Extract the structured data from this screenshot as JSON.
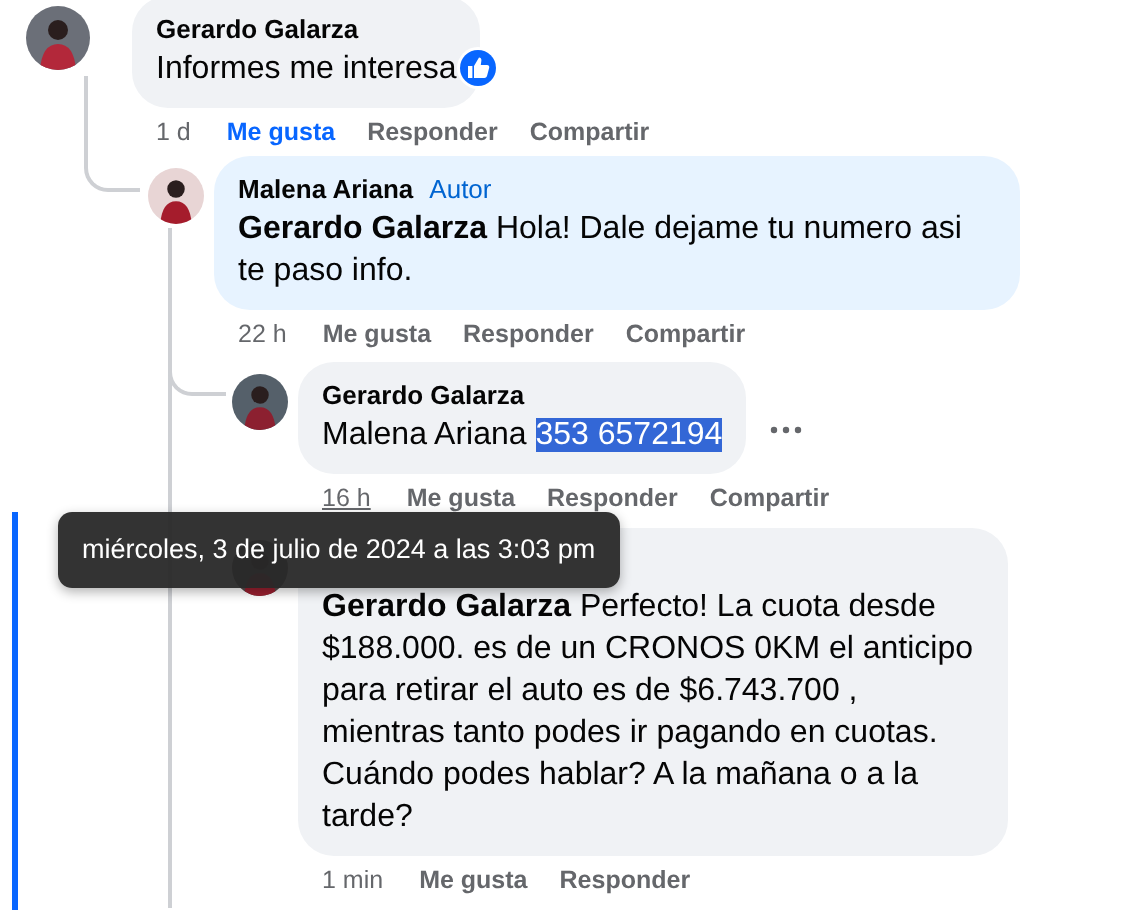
{
  "comments": [
    {
      "author": "Gerardo Galarza",
      "text": "Informes me interesa",
      "like_reaction": true,
      "highlighted": false,
      "more_menu": false,
      "time": "1 d",
      "time_hovered": false,
      "actions": [
        {
          "label": "Me gusta",
          "selected": true
        },
        {
          "label": "Responder",
          "selected": false
        },
        {
          "label": "Compartir",
          "selected": false
        }
      ],
      "children": [
        {
          "author": "Malena Ariana",
          "badge": "Autor",
          "is_author": true,
          "text": "**Gerardo Galarza** Hola! Dale dejame tu numero asi te paso info.",
          "like_reaction": false,
          "highlighted": false,
          "more_menu": false,
          "time": "22 h",
          "time_hovered": false,
          "actions": [
            {
              "label": "Me gusta",
              "selected": false
            },
            {
              "label": "Responder",
              "selected": false
            },
            {
              "label": "Compartir",
              "selected": false
            }
          ],
          "children": [
            {
              "author": "Gerardo Galarza",
              "text": "Malena Ariana ",
              "selected_text": "353 6572194",
              "like_reaction": false,
              "highlighted": false,
              "more_menu": true,
              "time": "16 h",
              "time_hovered": true,
              "actions": [
                {
                  "label": "Me gusta",
                  "selected": false
                },
                {
                  "label": "Responder",
                  "selected": false
                },
                {
                  "label": "Compartir",
                  "selected": false
                }
              ]
            },
            {
              "text": "**Gerardo Galarza** Perfecto! La cuota desde $188.000. es de un CRONOS 0KM el anticipo para retirar el auto es de $6.743.700 , mientras tanto podes ir pagando en cuotas. Cuándo podes hablar? A la mañana o a la tarde?",
              "is_author": false,
              "like_reaction": false,
              "highlighted": true,
              "more_menu": false,
              "time": "1 min",
              "time_hovered": false,
              "actions": [
                {
                  "label": "Me gusta",
                  "selected": false
                },
                {
                  "label": "Responder",
                  "selected": false
                }
              ]
            }
          ]
        }
      ]
    }
  ],
  "tooltip": {
    "text": "miércoles, 3 de julio de 2024 a las 3:03 pm"
  }
}
